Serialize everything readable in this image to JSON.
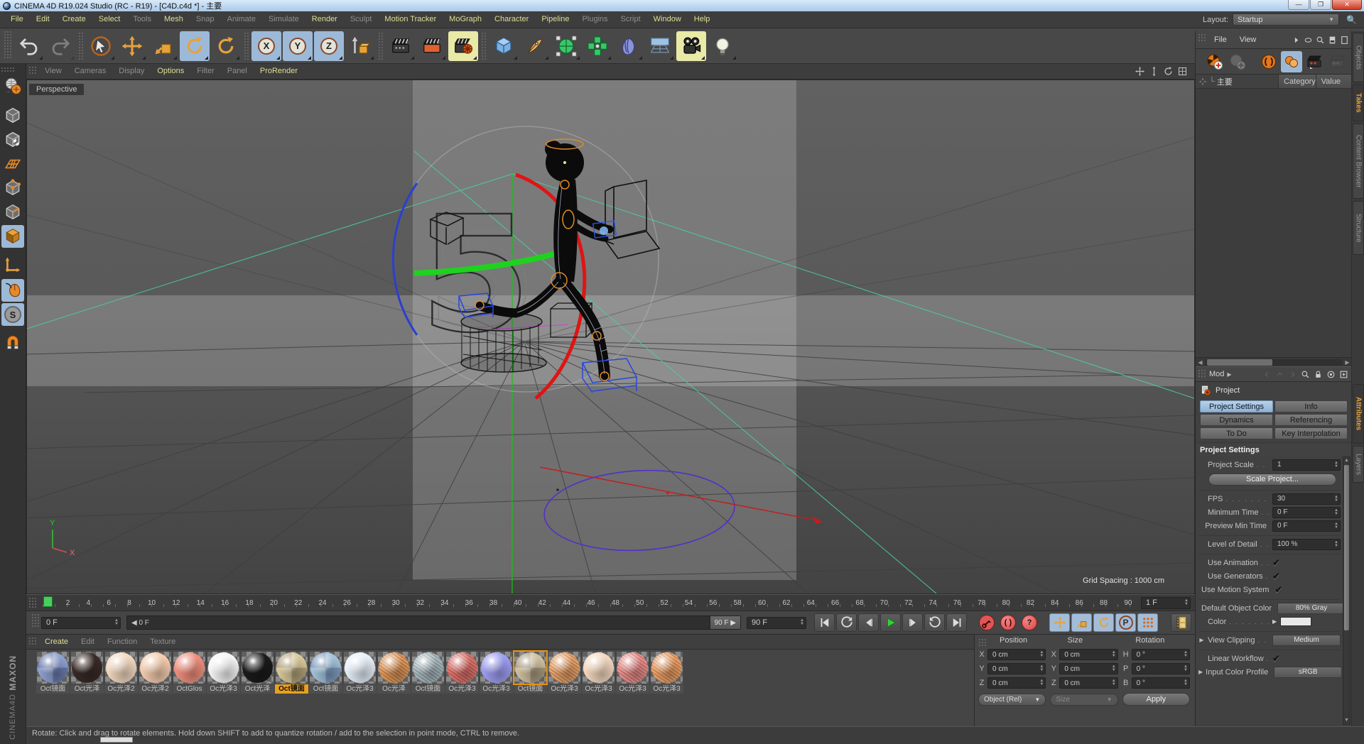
{
  "window": {
    "title": "CINEMA 4D R19.024 Studio (RC - R19) - [C4D.c4d *] - 主要",
    "minimize_glyph": "—",
    "restore_glyph": "❐",
    "close_glyph": "✕"
  },
  "menu_bar": {
    "items": [
      {
        "label": "File",
        "bright": true
      },
      {
        "label": "Edit",
        "bright": true
      },
      {
        "label": "Create",
        "bright": true
      },
      {
        "label": "Select",
        "bright": true
      },
      {
        "label": "Tools",
        "bright": false
      },
      {
        "label": "Mesh",
        "bright": true
      },
      {
        "label": "Snap",
        "bright": false
      },
      {
        "label": "Animate",
        "bright": false
      },
      {
        "label": "Simulate",
        "bright": false
      },
      {
        "label": "Render",
        "bright": true
      },
      {
        "label": "Sculpt",
        "bright": false
      },
      {
        "label": "Motion Tracker",
        "bright": true
      },
      {
        "label": "MoGraph",
        "bright": true
      },
      {
        "label": "Character",
        "bright": true
      },
      {
        "label": "Pipeline",
        "bright": true
      },
      {
        "label": "Plugins",
        "bright": false
      },
      {
        "label": "Script",
        "bright": false
      },
      {
        "label": "Window",
        "bright": true
      },
      {
        "label": "Help",
        "bright": true
      }
    ],
    "layout_label": "Layout:",
    "layout_value": "Startup"
  },
  "toolbar": {
    "buttons": [
      {
        "icon": "undo",
        "name": "undo-button"
      },
      {
        "icon": "redo",
        "name": "redo-button",
        "disabled": true
      },
      {
        "sep": true
      },
      {
        "icon": "live-selection",
        "name": "live-selection-tool"
      },
      {
        "icon": "move",
        "name": "move-tool"
      },
      {
        "icon": "scale",
        "name": "scale-tool"
      },
      {
        "icon": "rotate",
        "name": "rotate-tool",
        "active": "blue"
      },
      {
        "icon": "last-tool",
        "name": "last-tool-used"
      },
      {
        "sep": true
      },
      {
        "letter": "X",
        "name": "x-axis-lock-toggle",
        "active": "blue"
      },
      {
        "letter": "Y",
        "name": "y-axis-lock-toggle",
        "active": "blue"
      },
      {
        "letter": "Z",
        "name": "z-axis-lock-toggle",
        "active": "blue"
      },
      {
        "icon": "coord-system",
        "name": "coordinate-system-toggle"
      },
      {
        "sep": true
      },
      {
        "icon": "render-view",
        "name": "render-view-button"
      },
      {
        "icon": "render-pv",
        "name": "render-to-picture-viewer-button"
      },
      {
        "icon": "render-settings",
        "name": "edit-render-settings-button",
        "active": "yellow"
      },
      {
        "sep": true
      },
      {
        "icon": "cube",
        "name": "add-cube-object-button"
      },
      {
        "icon": "pen",
        "name": "spline-pen-button"
      },
      {
        "icon": "subdiv",
        "name": "subdivision-surface-button"
      },
      {
        "icon": "cloner",
        "name": "modeling-objects-button"
      },
      {
        "icon": "deformer",
        "name": "deformer-objects-button"
      },
      {
        "icon": "environment",
        "name": "environment-objects-button"
      },
      {
        "icon": "camera",
        "name": "camera-objects-button",
        "active": "yellow"
      },
      {
        "icon": "light",
        "name": "light-objects-button"
      }
    ]
  },
  "left_toolbar": {
    "buttons": [
      {
        "icon": "make-editable",
        "name": "make-editable-button"
      },
      {
        "sep": true
      },
      {
        "icon": "model-mode",
        "name": "model-mode-button"
      },
      {
        "icon": "texture-mode",
        "name": "texture-mode-button"
      },
      {
        "icon": "workplane-mode",
        "name": "workplane-mode-button"
      },
      {
        "icon": "points-mode",
        "name": "points-mode-button"
      },
      {
        "icon": "edges-mode",
        "name": "edges-mode-button"
      },
      {
        "icon": "polygons-mode",
        "name": "polygons-mode-button",
        "active": true
      },
      {
        "sep": true
      },
      {
        "icon": "axis-mode",
        "name": "enable-axis-modification-button"
      },
      {
        "icon": "tweak-mode",
        "name": "tweak-mode-button",
        "active": true
      },
      {
        "letter": "S",
        "name": "snap-toggle",
        "active": true
      },
      {
        "sep": true
      },
      {
        "icon": "magnet",
        "name": "magnet-tool-button"
      }
    ]
  },
  "viewport": {
    "menus": [
      {
        "label": "View",
        "bright": false
      },
      {
        "label": "Cameras",
        "bright": false
      },
      {
        "label": "Display",
        "bright": false
      },
      {
        "label": "Options",
        "bright": true
      },
      {
        "label": "Filter",
        "bright": false
      },
      {
        "label": "Panel",
        "bright": false
      },
      {
        "label": "ProRender",
        "bright": true
      }
    ],
    "nav_icons": [
      {
        "icon": "pan-view",
        "name": "pan-view-icon"
      },
      {
        "icon": "zoom-view",
        "name": "zoom-view-icon"
      },
      {
        "icon": "rotate-view",
        "name": "rotate-view-icon"
      },
      {
        "icon": "toggle-view",
        "name": "toggle-views-icon"
      }
    ],
    "camera_label": "Perspective",
    "grid_spacing": "Grid Spacing : 1000 cm",
    "axis_y": "Y",
    "axis_x": "X"
  },
  "timeline": {
    "ruler_labels": [
      0,
      2,
      4,
      6,
      8,
      10,
      12,
      14,
      16,
      18,
      20,
      22,
      24,
      26,
      28,
      30,
      32,
      34,
      36,
      38,
      40,
      42,
      44,
      46,
      48,
      50,
      52,
      54,
      56,
      58,
      60,
      62,
      64,
      66,
      68,
      70,
      72,
      74,
      76,
      78,
      80,
      82,
      84,
      86,
      88,
      90
    ],
    "step_field": "1 F",
    "current_frame": "0 F",
    "range_start_label": "0 F",
    "range_end_label": "90 F",
    "end_frame_field": "90 F",
    "transport": [
      {
        "icon": "goto-start",
        "name": "goto-start-button"
      },
      {
        "icon": "prev-key",
        "name": "previous-key-button"
      },
      {
        "icon": "prev-frame",
        "name": "previous-frame-button"
      },
      {
        "icon": "play",
        "name": "play-button"
      },
      {
        "icon": "next-frame",
        "name": "next-frame-button"
      },
      {
        "icon": "next-key",
        "name": "next-key-button"
      },
      {
        "icon": "goto-end",
        "name": "goto-end-button"
      }
    ],
    "record_buttons": [
      {
        "icon": "record-key",
        "name": "record-keyframe-button"
      },
      {
        "glyph": "( )",
        "name": "autokeying-toggle"
      },
      {
        "glyph": "?",
        "name": "keyframe-selection-button"
      }
    ],
    "record_toggles": [
      {
        "icon": "move",
        "name": "record-position-toggle"
      },
      {
        "icon": "scale",
        "name": "record-scale-toggle"
      },
      {
        "icon": "rotate",
        "name": "record-rotation-toggle"
      },
      {
        "letter": "P",
        "name": "record-parameter-toggle"
      },
      {
        "icon": "dots",
        "name": "record-pla-toggle"
      }
    ]
  },
  "materials": {
    "menus": [
      {
        "label": "Create",
        "bright": true
      },
      {
        "label": "Edit",
        "bright": false
      },
      {
        "label": "Function",
        "bright": false
      },
      {
        "label": "Texture",
        "bright": false
      }
    ],
    "items": [
      {
        "label": "Oct镜面",
        "style": "checker",
        "base": "#8fa0cf",
        "alt": "#6a7cb0"
      },
      {
        "label": "Oct光泽",
        "style": "solid",
        "base": "#382a26"
      },
      {
        "label": "Oc光泽2",
        "style": "solid",
        "base": "#f2d8c0"
      },
      {
        "label": "Oc光泽2",
        "style": "solid",
        "base": "#f4ccae"
      },
      {
        "label": "OctGlos",
        "style": "solid",
        "base": "#ef8e7d"
      },
      {
        "label": "Oc光泽3",
        "style": "solid",
        "base": "#f5f5f5"
      },
      {
        "label": "Oct光泽",
        "style": "solid",
        "base": "#1a1a1a"
      },
      {
        "label": "Oct镜面",
        "style": "checker",
        "base": "#d8c89a",
        "alt": "#b2a27a",
        "label_selected": true
      },
      {
        "label": "Oct镜面",
        "style": "checker",
        "base": "#a2c2da",
        "alt": "#7d9cc0"
      },
      {
        "label": "Oc光泽3",
        "style": "solid",
        "base": "#e6eef8"
      },
      {
        "label": "Oc光泽",
        "style": "textured",
        "base": "#e49a58"
      },
      {
        "label": "Oct镜面",
        "style": "textured",
        "base": "#a4bfca"
      },
      {
        "label": "Oc光泽3",
        "style": "textured",
        "base": "#e1716c"
      },
      {
        "label": "Oc光泽3",
        "style": "solid",
        "base": "#9d9df2"
      },
      {
        "label": "Oct镜面",
        "style": "checker",
        "base": "#cfc1a2",
        "alt": "#a99b80",
        "thumb_selected": true
      },
      {
        "label": "Oc光泽3",
        "style": "textured",
        "base": "#eca569"
      },
      {
        "label": "Oc光泽3",
        "style": "solid",
        "base": "#f3d8c0"
      },
      {
        "label": "Oc光泽3",
        "style": "textured",
        "base": "#ee8f8e"
      },
      {
        "label": "Oc光泽3",
        "style": "textured",
        "base": "#f1a366"
      }
    ]
  },
  "coordinates": {
    "columns": [
      {
        "header": "Position",
        "rows": [
          {
            "axis": "X",
            "value": "0 cm"
          },
          {
            "axis": "Y",
            "value": "0 cm"
          },
          {
            "axis": "Z",
            "value": "0 cm"
          }
        ],
        "footer": {
          "kind": "dropdown",
          "label": "Object (Rel)",
          "enabled": true,
          "name": "position-mode-dropdown"
        }
      },
      {
        "header": "Size",
        "rows": [
          {
            "axis": "X",
            "value": "0 cm"
          },
          {
            "axis": "Y",
            "value": "0 cm"
          },
          {
            "axis": "Z",
            "value": "0 cm"
          }
        ],
        "footer": {
          "kind": "dropdown",
          "label": "Size",
          "enabled": false,
          "name": "size-mode-dropdown"
        }
      },
      {
        "header": "Rotation",
        "rows": [
          {
            "axis": "H",
            "value": "0 °"
          },
          {
            "axis": "P",
            "value": "0 °"
          },
          {
            "axis": "B",
            "value": "0 °"
          }
        ],
        "footer": {
          "kind": "button",
          "label": "Apply",
          "name": "apply-button"
        }
      }
    ]
  },
  "object_manager": {
    "menus": [
      {
        "label": "File"
      },
      {
        "label": "View"
      }
    ],
    "menu_icons": [
      {
        "icon": "tri-right",
        "name": "more-menu-icon"
      },
      {
        "icon": "ellipse",
        "name": "filter-icon"
      },
      {
        "icon": "magnifier",
        "name": "search-icon"
      },
      {
        "icon": "panel-solid",
        "name": "panel-layout-icon"
      },
      {
        "icon": "panel-outline",
        "name": "panel-outline-icon"
      }
    ],
    "toolbar": [
      {
        "icon": "take-new",
        "name": "add-take-button"
      },
      {
        "icon": "take-child",
        "name": "add-child-take-button",
        "disabled": true
      },
      {
        "gap": true
      },
      {
        "icon": "auto-take",
        "name": "auto-take-toggle"
      },
      {
        "icon": "overrides",
        "name": "override-groups-button",
        "active": true
      },
      {
        "icon": "render-marked",
        "name": "render-marked-takes-button"
      },
      {
        "icon": "render-all",
        "name": "render-all-takes-button",
        "disabled": true
      }
    ],
    "take_root": "主要",
    "columns": [
      "Category",
      "Value"
    ],
    "side_tabs": [
      {
        "label": "Objects",
        "active": false
      },
      {
        "label": "Takes",
        "active": true
      },
      {
        "label": "Content Browser",
        "active": false
      },
      {
        "label": "Structure",
        "active": false
      }
    ]
  },
  "attribute_manager": {
    "mode_label": "Mod",
    "object_title": "Project",
    "tabs": [
      {
        "label": "Project Settings",
        "active": true
      },
      {
        "label": "Info",
        "active": false
      },
      {
        "label": "Dynamics",
        "active": false
      },
      {
        "label": "Referencing",
        "active": false
      },
      {
        "label": "To Do",
        "active": false
      },
      {
        "label": "Key Interpolation",
        "active": false
      }
    ],
    "section_title": "Project Settings",
    "rows": [
      {
        "type": "spinner",
        "label": "Project Scale",
        "value": "1",
        "name": "project-scale-field"
      },
      {
        "type": "button",
        "label": "Scale Project...",
        "name": "scale-project-button"
      },
      {
        "type": "sep"
      },
      {
        "type": "spinner",
        "label": "FPS",
        "value": "30",
        "name": "fps-field"
      },
      {
        "type": "spinner",
        "label": "Minimum Time",
        "value": "0 F",
        "name": "minimum-time-field"
      },
      {
        "type": "spinner",
        "label": "Preview Min Time",
        "value": "0 F",
        "name": "preview-min-time-field"
      },
      {
        "type": "sep"
      },
      {
        "type": "spinner",
        "label": "Level of Detail",
        "value": "100 %",
        "name": "level-of-detail-field"
      },
      {
        "type": "sep"
      },
      {
        "type": "check",
        "label": "Use Animation",
        "checked": true,
        "name": "use-animation-checkbox"
      },
      {
        "type": "check",
        "label": "Use Generators",
        "checked": true,
        "name": "use-generators-checkbox"
      },
      {
        "type": "check",
        "label": "Use Motion System",
        "checked": true,
        "name": "use-motion-system-checkbox"
      },
      {
        "type": "sep"
      },
      {
        "type": "dropdown",
        "label": "Default Object Color",
        "value": "80% Gray",
        "name": "default-object-color-dropdown"
      },
      {
        "type": "color",
        "label": "Color",
        "swatch": "#e8e8e8",
        "name": "color-swatch-field"
      },
      {
        "type": "sep"
      },
      {
        "type": "dropdown",
        "label": "View Clipping",
        "value": "Medium",
        "expand": true,
        "name": "view-clipping-dropdown"
      },
      {
        "type": "sep"
      },
      {
        "type": "check",
        "label": "Linear Workflow",
        "checked": true,
        "name": "linear-workflow-checkbox"
      },
      {
        "type": "dropdown",
        "label": "Input Color Profile",
        "value": "sRGB",
        "expand": true,
        "name": "input-color-profile-dropdown"
      }
    ],
    "side_tabs": [
      {
        "label": "Attributes",
        "active": true
      },
      {
        "label": "Layers",
        "active": false
      }
    ]
  },
  "status_bar": {
    "text": "Rotate: Click and drag to rotate elements. Hold down SHIFT to add to quantize rotation / add to the selection in point mode, CTRL to remove."
  },
  "branding": {
    "maxon": "MAXON",
    "cinema": "CINEMA4D"
  }
}
